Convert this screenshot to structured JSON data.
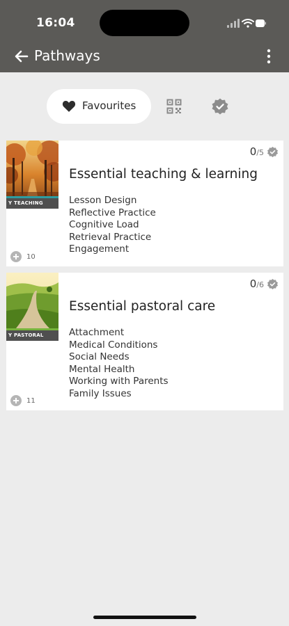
{
  "status_bar": {
    "time": "16:04"
  },
  "app_bar": {
    "title": "Pathways",
    "back_icon": "back-arrow-icon",
    "more_icon": "more-vert-icon"
  },
  "segments": {
    "favourites_label": "Favourites",
    "qr_icon": "qr-code-icon",
    "badge_icon": "verified-badge-icon"
  },
  "pathways": [
    {
      "title": "Essential teaching & learning",
      "tag": "TEACHING",
      "progress_done": "0",
      "progress_total": "/5",
      "topics": [
        "Lesson Design",
        "Reflective Practice",
        "Cognitive Load",
        "Retrieval Practice",
        "Engagement"
      ],
      "count": "10",
      "accent": "#2e9ca0"
    },
    {
      "title": "Essential pastoral care",
      "tag": "PASTORAL",
      "progress_done": "0",
      "progress_total": "/6",
      "topics": [
        "Attachment",
        "Medical Conditions",
        "Social Needs",
        "Mental Health",
        "Working with Parents",
        "Family Issues"
      ],
      "count": "11",
      "accent": "#77b43d"
    }
  ],
  "colors": {
    "app_bar": "#5b5a57",
    "background": "#ececec",
    "card": "#ffffff"
  }
}
